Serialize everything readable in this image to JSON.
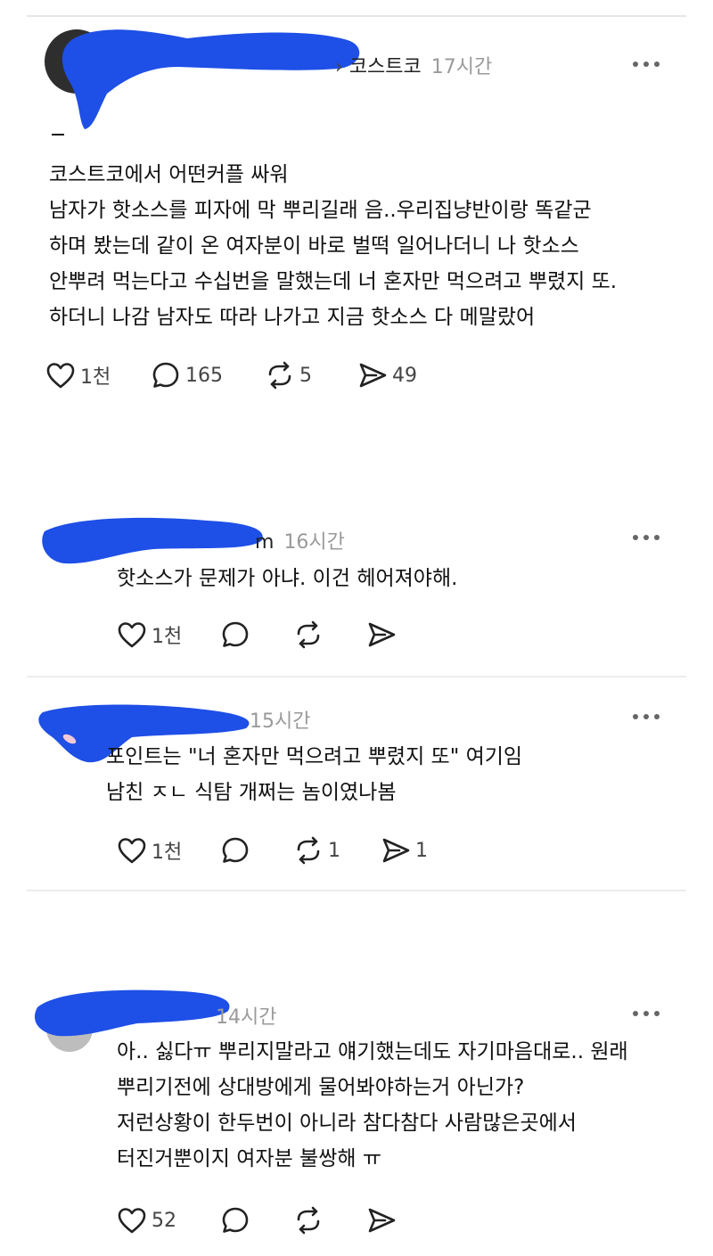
{
  "colors": {
    "redact": "#1e4fe6",
    "time": "#9a9a9a",
    "icon": "#222222"
  },
  "post": {
    "author": "코스트코",
    "time": "17시간",
    "body": [
      "코스트코에서 어떤커플 싸워",
      "남자가 핫소스를 피자에 막 뿌리길래 음..우리집냥반이랑 똑같군",
      "하며 봤는데 같이 온 여자분이 바로 벌떡 일어나더니 나 핫소스",
      "안뿌려 먹는다고 수십번을 말했는데 너 혼자만 먹으려고 뿌렸지 또.",
      "하더니 나감 남자도 따라 나가고 지금 핫소스 다 메말랐어"
    ],
    "likes": "1천",
    "comments": "165",
    "reposts": "5",
    "shares": "49"
  },
  "replies": [
    {
      "author_tail": "m",
      "time": "16시간",
      "body": [
        "핫소스가 문제가 아냐. 이건 헤어져야해."
      ],
      "likes": "1천",
      "comments": "",
      "reposts": "",
      "shares": ""
    },
    {
      "author_tail": "",
      "time": "15시간",
      "body": [
        "포인트는 \"너 혼자만 먹으려고 뿌렸지 또\" 여기임",
        "남친 ㅈㄴ 식탐 개쩌는 놈이였나봄"
      ],
      "likes": "1천",
      "comments": "",
      "reposts": "1",
      "shares": "1"
    },
    {
      "author_tail": "",
      "time": "14시간",
      "body": [
        "아.. 싫다ㅠ 뿌리지말라고 얘기했는데도 자기마음대로.. 원래",
        "뿌리기전에 상대방에게 물어봐야하는거 아닌가?",
        "저런상황이 한두번이 아니라 참다참다 사람많은곳에서",
        "터진거뿐이지 여자분 불쌍해 ㅠ"
      ],
      "likes": "52",
      "comments": "",
      "reposts": "",
      "shares": ""
    }
  ]
}
